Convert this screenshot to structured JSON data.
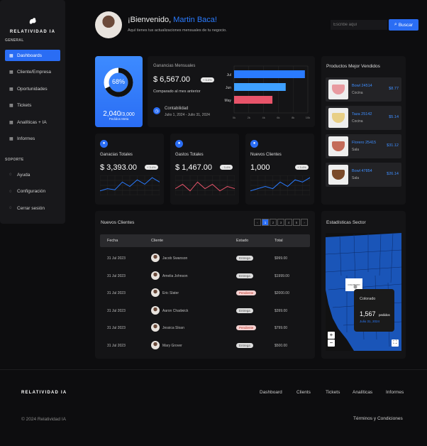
{
  "brand": {
    "name": "RELATIVIDAD IA"
  },
  "sidebar": {
    "general_label": "GENERAL",
    "support_label": "SOPORTE",
    "items": [
      {
        "label": "Dashboards",
        "icon": "grid-icon"
      },
      {
        "label": "Cliente/Empresa",
        "icon": "building-icon"
      },
      {
        "label": "Oportunidades",
        "icon": "bell-icon"
      },
      {
        "label": "Tickets",
        "icon": "cart-icon"
      },
      {
        "label": "Analíticas + IA",
        "icon": "chart-icon"
      },
      {
        "label": "Informes",
        "icon": "document-icon"
      }
    ],
    "support_items": [
      {
        "label": "Ayuda",
        "icon": "help-icon"
      },
      {
        "label": "Configuración",
        "icon": "gear-icon"
      },
      {
        "label": "Cerrar sesión",
        "icon": "logout-icon"
      }
    ]
  },
  "header": {
    "greeting": "¡Bienvenido, ",
    "user_name": "Martin Baca!",
    "subtitle": "Aquí tienes tus actualizaciones mensuales de tu negocio.",
    "search_placeholder": "Escribe aquí",
    "search_button": "Buscar"
  },
  "meta_card": {
    "percent": "68%",
    "value": "2,040",
    "total": "/3,000",
    "label": "Pedidos Meta",
    "fraction": 0.68
  },
  "earnings": {
    "title": "Ganancias Mensuales",
    "amount": "$ 6,567.00",
    "badge": "+ 5.0%",
    "compare": "Comparado al mes anterior",
    "account_label": "Contabilidad",
    "date_range": "Julio 1, 2024 - Julio 31, 2024"
  },
  "chart_data": {
    "type": "bar",
    "orientation": "horizontal",
    "categories": [
      "Jul",
      "Jun",
      "May"
    ],
    "values": [
      96,
      70,
      52
    ],
    "colors": [
      "#2a7bff",
      "#3ea0ff",
      "#e8546a"
    ],
    "xlim": [
      0,
      100
    ],
    "x_ticks": [
      "0k",
      "2k",
      "4k",
      "6k",
      "8k",
      "10k"
    ]
  },
  "stats": [
    {
      "title": "Ganacias Totales",
      "value": "$ 3,393.00",
      "badge": "+ 3.4%",
      "color": "#2a7bff",
      "series": [
        2,
        3,
        2.5,
        6,
        4,
        7,
        5,
        8,
        6
      ]
    },
    {
      "title": "Gastos Totales",
      "value": "$ 1,467.00",
      "badge": "- 3.4%",
      "color": "#e8546a",
      "series": [
        3,
        5,
        2,
        6,
        3,
        5,
        2,
        4,
        3
      ]
    },
    {
      "title": "Nuevos Clientes",
      "value": "1,000",
      "badge": "+ 3.4%",
      "color": "#2a7bff",
      "series": [
        2,
        3,
        4,
        3,
        6,
        4,
        7,
        6,
        8
      ]
    }
  ],
  "products": {
    "title": "Productos Mejor Vendidos",
    "items": [
      {
        "name": "Bowl 24514",
        "category": "Cocina",
        "price": "$8.77",
        "color": "#e89aa0"
      },
      {
        "name": "Taza 25142",
        "category": "Cocina",
        "price": "$5.14",
        "color": "#e8cf86"
      },
      {
        "name": "Florero 25415",
        "category": "Sala",
        "price": "$31.12",
        "color": "#c46b59"
      },
      {
        "name": "Bowl 47854",
        "category": "Sala",
        "price": "$26.14",
        "color": "#7a4a2a"
      }
    ]
  },
  "clients": {
    "title": "Nuevos Clientes",
    "pages": [
      "‹",
      "1",
      "2",
      "3",
      "4",
      "5",
      "›"
    ],
    "headers": [
      "Fecha",
      "Cliente",
      "Estado",
      "Total"
    ],
    "rows": [
      {
        "date": "31 Jul 2023",
        "name": "Jacob Swanson",
        "status": "Entrega",
        "total": "$999.00",
        "pending": false
      },
      {
        "date": "31 Jul 2023",
        "name": "Amelia Johnson",
        "status": "Entrega",
        "total": "$1999.00",
        "pending": false
      },
      {
        "date": "31 Jul 2023",
        "name": "Eric Slater",
        "status": "Pendiente",
        "total": "$2000.00",
        "pending": true
      },
      {
        "date": "31 Jul 2023",
        "name": "Aaron Chadwick",
        "status": "Entrega",
        "total": "$399.00",
        "pending": false
      },
      {
        "date": "31 Jul 2023",
        "name": "Jessica Sloan",
        "status": "Pendiente",
        "total": "$799.00",
        "pending": true
      },
      {
        "date": "31 Jul 2023",
        "name": "Mary Grover",
        "status": "Entrega",
        "total": "$500.00",
        "pending": false
      }
    ]
  },
  "map": {
    "title": "Estadísticas Sector",
    "selected_state": "COLORADO",
    "tooltip_state": "Colorado",
    "tooltip_value": "1,567",
    "tooltip_unit": "pedidos",
    "tooltip_date": "Julio 31, 2024",
    "zoom_in": "+",
    "zoom_out": "−"
  },
  "footer": {
    "brand": "RELATIVIDAD IA",
    "links": [
      "Dashboard",
      "Clients",
      "Tickets",
      "Analíticas",
      "Informes"
    ],
    "copyright": "© 2024 Relatividad IA",
    "terms": "Términos y Condiciones"
  }
}
